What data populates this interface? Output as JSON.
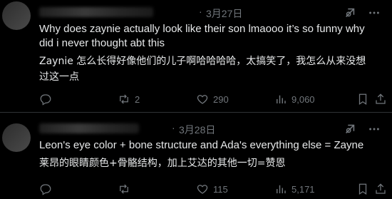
{
  "posts": [
    {
      "date": "3月27日",
      "dot": "·",
      "text_en": "Why does zaynie actually look like their son lmaooo it’s so funny why did i never thought abt this",
      "text_zh": "Zaynie 怎么长得好像他们的儿子啊哈哈哈哈，太搞笑了，我怎么从来没想过这一点",
      "reposts": "2",
      "likes": "290",
      "views": "9,060"
    },
    {
      "date": "3月28日",
      "dot": "·",
      "text_en": "Leon's eye color + bone structure and Ada's everything else = Zayne",
      "text_zh": "莱昂的眼睛颜色+骨骼结构，加上艾达的其他一切=赞恩",
      "reposts": "",
      "likes": "115",
      "views": "5,171"
    }
  ],
  "icons": [
    "reply-icon",
    "repost-icon",
    "like-icon",
    "views-icon",
    "bookmark-icon",
    "share-icon",
    "grok-icon",
    "more-icon"
  ]
}
